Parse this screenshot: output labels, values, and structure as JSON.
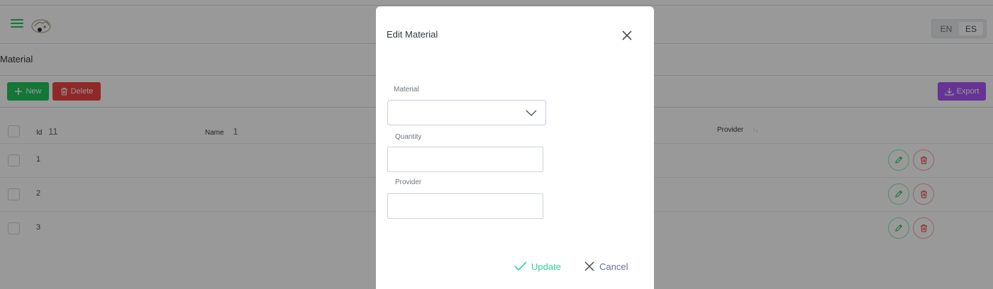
{
  "header": {
    "menu_icon": "hamburger-icon",
    "logo_icon": "brand-logo",
    "languages": [
      "EN",
      "ES"
    ],
    "active_language": "ES"
  },
  "page": {
    "title": "Material"
  },
  "toolbar": {
    "new_label": "New",
    "delete_label": "Delete",
    "export_label": "Export"
  },
  "table": {
    "columns": {
      "id": "Id",
      "id_sort": "11",
      "name": "Name",
      "name_sort": "1",
      "provider": "Provider",
      "provider_sort": "↑↓"
    },
    "rows": [
      {
        "id": "1"
      },
      {
        "id": "2"
      },
      {
        "id": "3"
      }
    ]
  },
  "dialog": {
    "title": "Edit Material",
    "fields": {
      "material_label": "Material",
      "material_value": "",
      "quantity_label": "Quantity",
      "quantity_value": "",
      "provider_label": "Provider",
      "provider_value": ""
    },
    "update_label": "Update",
    "cancel_label": "Cancel"
  },
  "colors": {
    "success": "#22c55e",
    "danger": "#ef4444",
    "help": "#a855f7",
    "update_text": "#34d399",
    "cancel_text": "#64748b"
  }
}
